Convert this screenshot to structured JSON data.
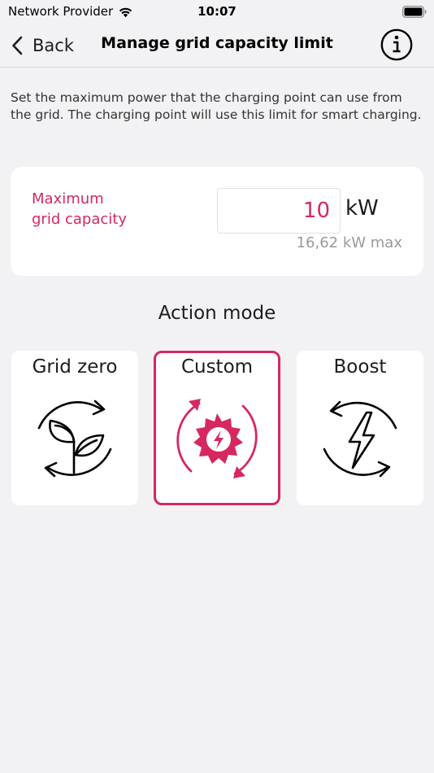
{
  "status_bar": {
    "carrier": "Network Provider",
    "time": "10:07",
    "icons": [
      "wifi-icon",
      "battery-icon"
    ]
  },
  "nav": {
    "back_label": "Back",
    "title": "Manage grid capacity limit",
    "info_icon": "info-circle-icon"
  },
  "description": "Set the maximum power that the charging point can use from the grid. The charging point will use this limit for smart charging.",
  "capacity": {
    "label_line1": "Maximum",
    "label_line2": "grid capacity",
    "value": "10",
    "unit": "kW",
    "max_text": "16,62 kW max"
  },
  "action_mode": {
    "title": "Action mode",
    "selected": "custom",
    "modes": [
      {
        "id": "grid-zero",
        "label": "Grid zero",
        "icon": "leaf-cycle-icon"
      },
      {
        "id": "custom",
        "label": "Custom",
        "icon": "sun-bolt-cycle-icon"
      },
      {
        "id": "boost",
        "label": "Boost",
        "icon": "bolt-cycle-icon"
      }
    ]
  },
  "colors": {
    "accent": "#d6285f",
    "background": "#f2f2f4",
    "card": "#ffffff",
    "text": "#1c1c1e",
    "muted": "#9a9a9e"
  }
}
